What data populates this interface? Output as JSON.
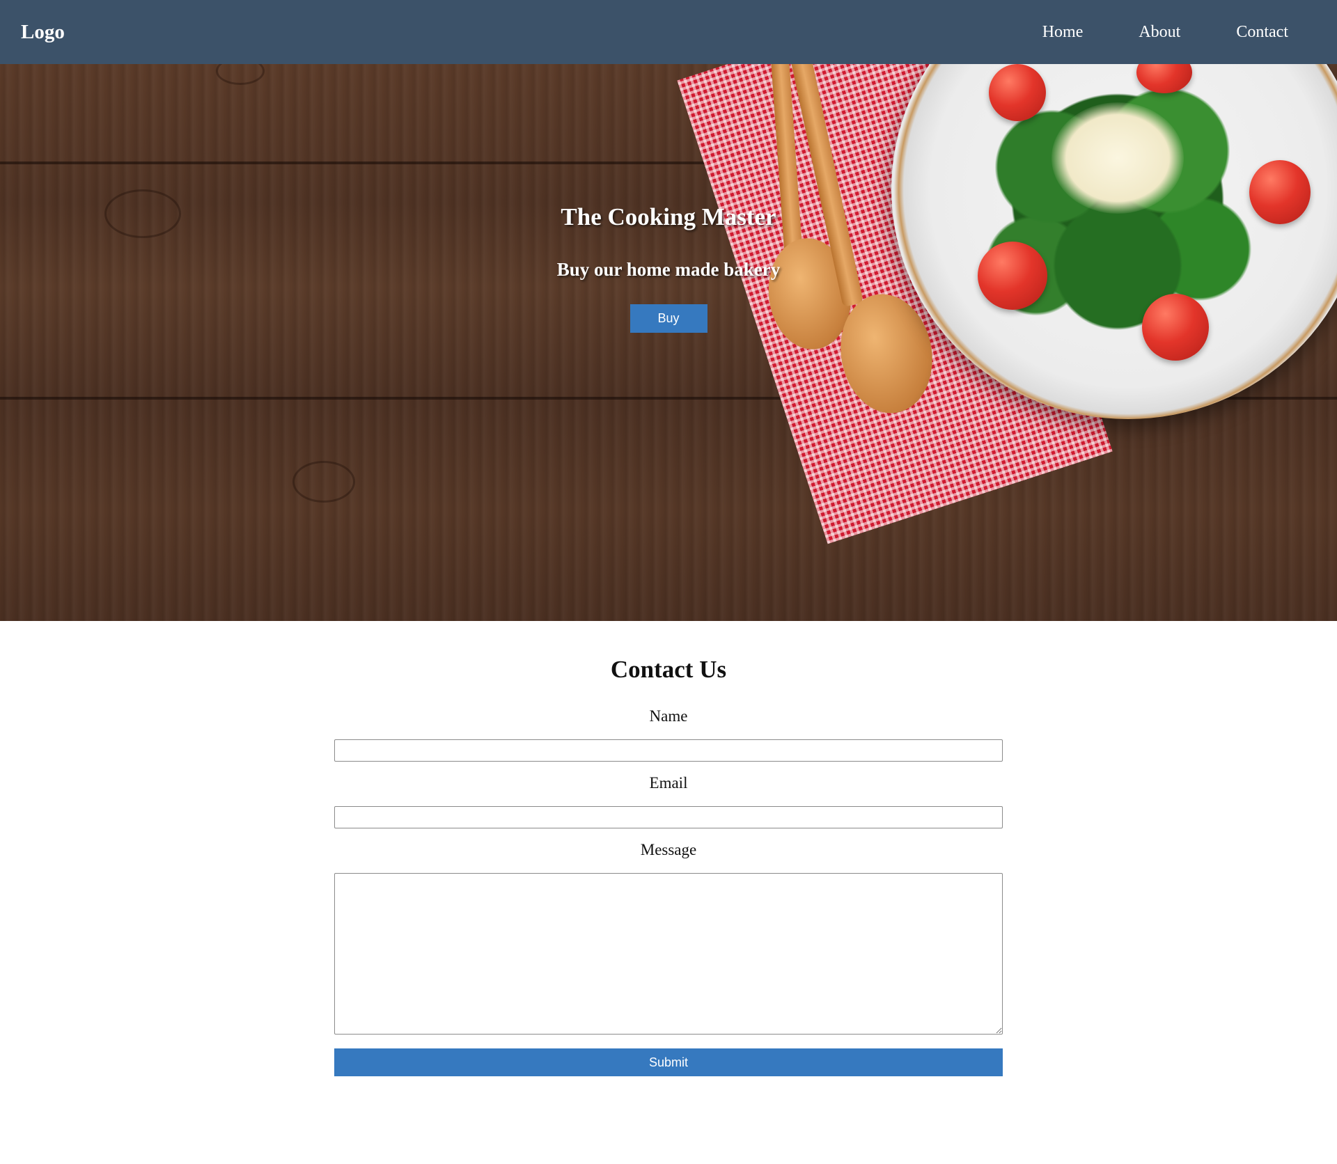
{
  "header": {
    "logo": "Logo",
    "nav": [
      {
        "label": "Home"
      },
      {
        "label": "About"
      },
      {
        "label": "Contact"
      }
    ]
  },
  "hero": {
    "title": "The Cooking Master",
    "subtitle": "Buy our home made bakery",
    "buy_label": "Buy"
  },
  "contact": {
    "title": "Contact Us",
    "name_label": "Name",
    "name_value": "",
    "email_label": "Email",
    "email_value": "",
    "message_label": "Message",
    "message_value": "",
    "submit_label": "Submit"
  },
  "colors": {
    "header_bg": "#3c5269",
    "button_bg": "#3679bf",
    "text_on_dark": "#ffffff"
  }
}
